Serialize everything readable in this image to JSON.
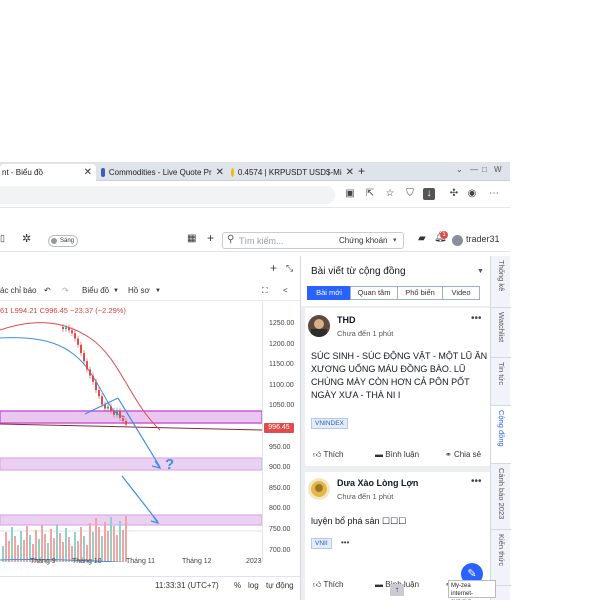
{
  "browser": {
    "tabs": [
      {
        "label": "nt - Biểu đồ",
        "close": "✕",
        "active": true
      },
      {
        "label": "Commodities - Live Quote Pr",
        "close": "✕",
        "active": false
      },
      {
        "label": "0.4574 | KRPUSDT USD$-Mi",
        "close": "✕",
        "active": false
      }
    ],
    "new_tab": "+",
    "window_controls": [
      "⌄",
      "—",
      "□",
      "W"
    ]
  },
  "tv_toolbar": {
    "sang_label": "Sáng",
    "search_placeholder": "Tìm kiếm...",
    "market_select": "Chứng khoán",
    "notification_count": "1",
    "username": "trader31"
  },
  "chart_toolbar": {
    "items": [
      "ác chỉ báo",
      "Biểu đồ",
      "Hồ sơ"
    ]
  },
  "ohlc": {
    "text": "61 L994.21  C996.45  −23.37 (−2.29%)"
  },
  "current_price_badge": "996.45",
  "chart_data": {
    "type": "bar",
    "ylim": [
      690,
      1260
    ],
    "price_ticks": [
      "1250.00",
      "1200.00",
      "1150.00",
      "1100.00",
      "1050.00",
      "1000.00",
      "950.00",
      "900.00",
      "850.00",
      "800.00",
      "750.00",
      "700.00"
    ],
    "time_ticks": [
      "Tháng 9",
      "Tháng 10",
      "Tháng 11",
      "Tháng 12",
      "2023"
    ],
    "last_price": 996.45,
    "annotation": "?"
  },
  "bottom_bar": {
    "time": "11:33:31 (UTC+7)",
    "percent": "%",
    "log": "log",
    "auto": "tự động"
  },
  "community": {
    "title": "Bài viết từ cộng đồng",
    "tabs": [
      {
        "label": "Bài mới",
        "active": true
      },
      {
        "label": "Quan tâm",
        "active": false
      },
      {
        "label": "Phổ biến",
        "active": false
      },
      {
        "label": "Video",
        "active": false
      }
    ],
    "posts": [
      {
        "author": "THD",
        "time": "Chưa đến 1 phút",
        "text": "SÚC SINH - SÚC ĐỘNG VẬT - MỘT LŨ ĂN XƯƠNG UỐNG MÁU ĐỒNG BÀO. LŨ CHÚNG MÀY CÒN HƠN CẢ PÔN PỐT NGÀY XƯA - THÀ NI I",
        "tag": "VNINDEX",
        "like": "Thích",
        "comment": "Bình luận",
        "share": "Chia sẻ"
      },
      {
        "author": "Dưa Xào Lòng Lợn",
        "time": "Chưa đến 1 phút",
        "text": "luyện bổ phá sản ☐☐☐",
        "tag": "VNII",
        "like": "Thích",
        "comment": "Bình luận",
        "share": "C"
      }
    ]
  },
  "side_tabs": [
    "Thống kê",
    "Watchlist",
    "Tin tức",
    "Cộng đồng",
    "Cảnh báo 2023",
    "Kiến thức"
  ],
  "tooltip": {
    "line1": "My-zea",
    "line2": "internet-surveys"
  },
  "colors": {
    "accent": "#2962ff",
    "price_badge": "#e24b4b",
    "band_purple": "#c85ad8",
    "ohlc_red": "#e0403f"
  }
}
